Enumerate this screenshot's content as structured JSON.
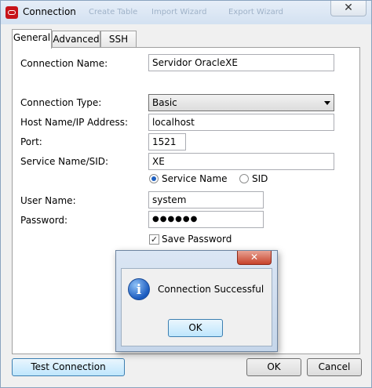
{
  "window": {
    "title": "Connection",
    "background_toolbar": [
      "Create Table",
      "Import Wizard",
      "Export Wizard"
    ],
    "close_glyph": "✕"
  },
  "tabs": [
    {
      "label": "General",
      "active": true
    },
    {
      "label": "Advanced",
      "active": false
    },
    {
      "label": "SSH",
      "active": false
    }
  ],
  "form": {
    "connection_name_label": "Connection Name:",
    "connection_name_value": "Servidor OracleXE",
    "connection_type_label": "Connection Type:",
    "connection_type_value": "Basic",
    "host_label": "Host Name/IP Address:",
    "host_value": "localhost",
    "port_label": "Port:",
    "port_value": "1521",
    "service_label": "Service Name/SID:",
    "service_value": "XE",
    "radio_service_name": "Service Name",
    "radio_sid": "SID",
    "user_label": "User Name:",
    "user_value": "system",
    "password_label": "Password:",
    "password_value": "●●●●●●",
    "save_password_label": "Save Password",
    "save_password_checked": true
  },
  "buttons": {
    "test_connection": "Test Connection",
    "ok": "OK",
    "cancel": "Cancel"
  },
  "dialog": {
    "close_glyph": "✕",
    "message": "Connection Successful",
    "ok": "OK"
  }
}
